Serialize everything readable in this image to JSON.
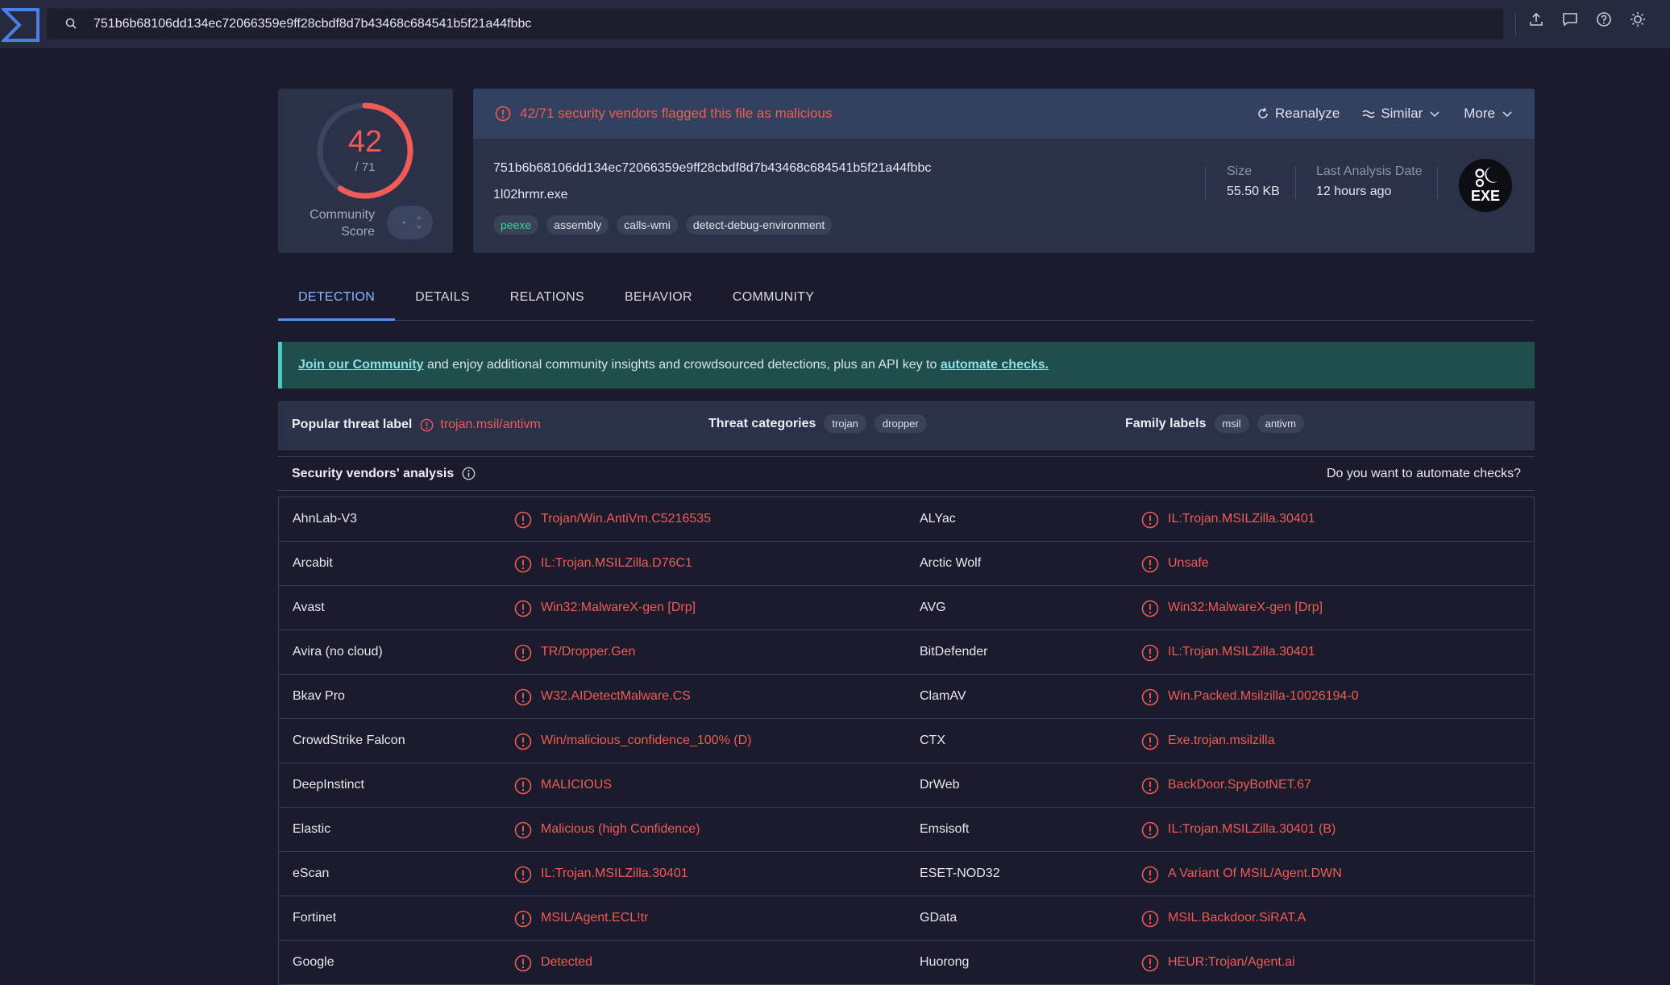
{
  "search": {
    "query": "751b6b68106dd134ec72066359e9ff28cbdf8d7b43468c684541b5f21a44fbbc"
  },
  "score": {
    "detections": "42",
    "total": "/ 71",
    "community_label_1": "Community",
    "community_label_2": "Score",
    "fraction": 0.5915
  },
  "header": {
    "alert": "42/71 security vendors flagged this file as malicious",
    "actions": {
      "reanalyze": "Reanalyze",
      "similar": "Similar",
      "more": "More"
    },
    "hash": "751b6b68106dd134ec72066359e9ff28cbdf8d7b43468c684541b5f21a44fbbc",
    "filename": "1l02hrmr.exe",
    "tags": [
      "peexe",
      "assembly",
      "calls-wmi",
      "detect-debug-environment"
    ],
    "size_label": "Size",
    "size_value": "55.50 KB",
    "date_label": "Last Analysis Date",
    "date_value": "12 hours ago",
    "file_type": "EXE"
  },
  "tabs": [
    "DETECTION",
    "DETAILS",
    "RELATIONS",
    "BEHAVIOR",
    "COMMUNITY"
  ],
  "banner": {
    "link1": "Join our Community",
    "middle": " and enjoy additional community insights and crowdsourced detections, plus an API key to ",
    "link2": "automate checks."
  },
  "threat": {
    "popular_label": "Popular threat label",
    "popular_value": "trojan.msil/antivm",
    "categories_label": "Threat categories",
    "categories": [
      "trojan",
      "dropper"
    ],
    "family_label": "Family labels",
    "families": [
      "msil",
      "antivm"
    ]
  },
  "vendors_header": {
    "title": "Security vendors' analysis",
    "automate": "Do you want to automate checks?"
  },
  "vendors": [
    [
      "AhnLab-V3",
      "Trojan/Win.AntiVm.C5216535",
      "ALYac",
      "IL:Trojan.MSILZilla.30401"
    ],
    [
      "Arcabit",
      "IL:Trojan.MSILZilla.D76C1",
      "Arctic Wolf",
      "Unsafe"
    ],
    [
      "Avast",
      "Win32:MalwareX-gen [Drp]",
      "AVG",
      "Win32:MalwareX-gen [Drp]"
    ],
    [
      "Avira (no cloud)",
      "TR/Dropper.Gen",
      "BitDefender",
      "IL:Trojan.MSILZilla.30401"
    ],
    [
      "Bkav Pro",
      "W32.AIDetectMalware.CS",
      "ClamAV",
      "Win.Packed.Msilzilla-10026194-0"
    ],
    [
      "CrowdStrike Falcon",
      "Win/malicious_confidence_100% (D)",
      "CTX",
      "Exe.trojan.msilzilla"
    ],
    [
      "DeepInstinct",
      "MALICIOUS",
      "DrWeb",
      "BackDoor.SpyBotNET.67"
    ],
    [
      "Elastic",
      "Malicious (high Confidence)",
      "Emsisoft",
      "IL:Trojan.MSILZilla.30401 (B)"
    ],
    [
      "eScan",
      "IL:Trojan.MSILZilla.30401",
      "ESET-NOD32",
      "A Variant Of MSIL/Agent.DWN"
    ],
    [
      "Fortinet",
      "MSIL/Agent.ECL!tr",
      "GData",
      "MSIL.Backdoor.SiRAT.A"
    ],
    [
      "Google",
      "Detected",
      "Huorong",
      "HEUR:Trojan/Agent.ai"
    ]
  ],
  "colors": {
    "malicious": "#f05b56",
    "accent": "#5b8ef0",
    "background": "#1a1b2c"
  }
}
